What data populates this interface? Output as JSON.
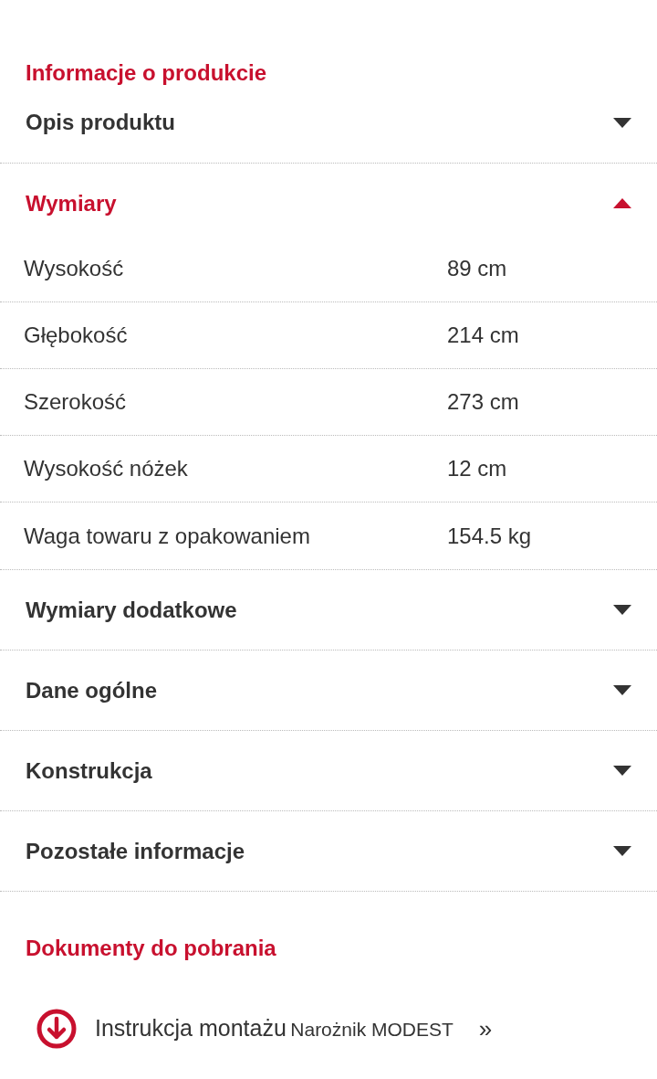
{
  "heading": "Informacje o produkcie",
  "sections": [
    {
      "title": "Opis produktu",
      "expanded": false
    },
    {
      "title": "Wymiary",
      "expanded": true,
      "rows": [
        {
          "label": "Wysokość",
          "value": "89 cm"
        },
        {
          "label": "Głębokość",
          "value": "214 cm"
        },
        {
          "label": "Szerokość",
          "value": "273 cm"
        },
        {
          "label": "Wysokość nóżek",
          "value": "12 cm"
        },
        {
          "label": "Waga towaru z opakowaniem",
          "value": "154.5 kg"
        }
      ]
    },
    {
      "title": "Wymiary dodatkowe",
      "expanded": false
    },
    {
      "title": "Dane ogólne",
      "expanded": false
    },
    {
      "title": "Konstrukcja",
      "expanded": false
    },
    {
      "title": "Pozostałe informacje",
      "expanded": false
    }
  ],
  "documents": {
    "heading": "Dokumenty do pobrania",
    "items": [
      {
        "title": "Instrukcja montażu",
        "subtitle": "Narożnik MODEST",
        "arrow": "»"
      }
    ]
  }
}
